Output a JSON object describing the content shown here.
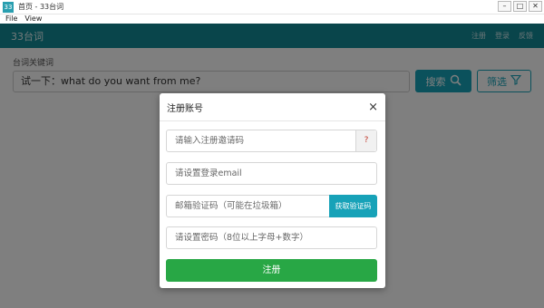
{
  "window": {
    "icon_text": "33",
    "title": "首页 - 33台词",
    "menu": [
      "File",
      "View"
    ],
    "controls": {
      "minimize": "–",
      "maximize": "□",
      "close": "✕"
    }
  },
  "navbar": {
    "brand": "33台词",
    "links": [
      "注册",
      "登录",
      "反馈"
    ]
  },
  "search": {
    "label": "台词关键词",
    "value": "试一下：what do you want from me?",
    "button_label": "搜索",
    "filter_label": "筛选"
  },
  "modal": {
    "title": "注册账号",
    "close": "×",
    "invite_placeholder": "请输入注册邀请码",
    "invite_help": "?",
    "email_placeholder": "请设置登录email",
    "code_placeholder": "邮箱验证码（可能在垃圾箱）",
    "code_button": "获取验证码",
    "password_placeholder": "请设置密码（8位以上字母+数字）",
    "submit_label": "注册"
  },
  "colors": {
    "navbar": "#138a97",
    "primary": "#17a2b8",
    "success": "#28a745",
    "help": "#c0392b"
  },
  "icons": [
    "search-icon",
    "filter-icon",
    "close-icon"
  ]
}
